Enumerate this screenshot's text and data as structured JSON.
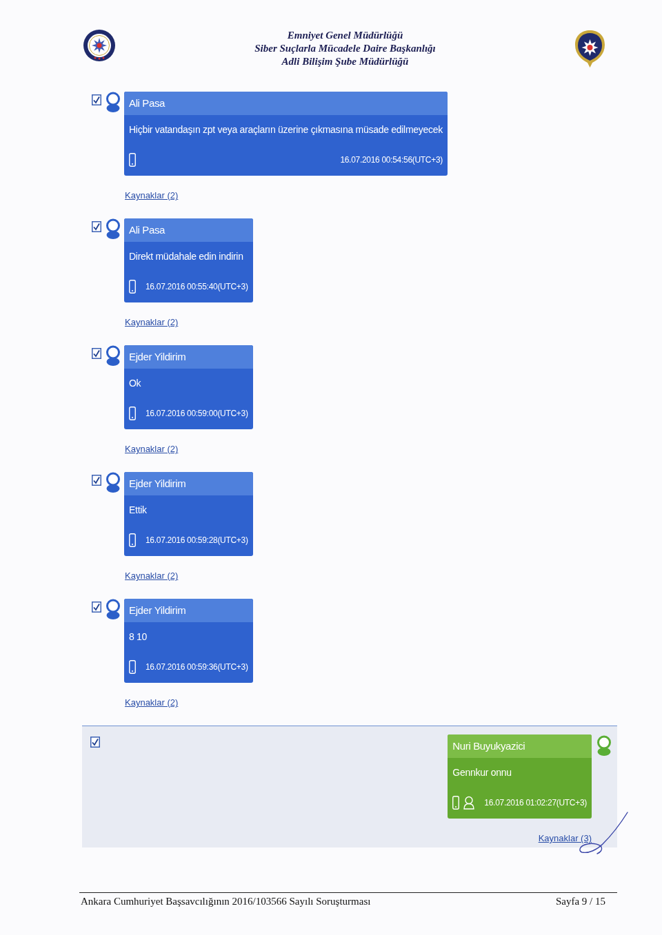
{
  "header": {
    "lines": [
      "Emniyet Genel Müdürlüğü",
      "Siber Suçlarla Mücadele Daire Başkanlığı",
      "Adli Bilişim Şube Müdürlüğü"
    ]
  },
  "messages": [
    {
      "kind": "incoming",
      "checked": true,
      "selected": false,
      "sender": "Ali Pasa",
      "text": "Hiçbir vatandaşın zpt veya araçların üzerine çıkmasına müsade edilmeyecek",
      "timestamp": "16.07.2016 00:54:56(UTC+3)",
      "sources": "Kaynaklar (2)"
    },
    {
      "kind": "incoming",
      "checked": true,
      "selected": false,
      "sender": "Ali Pasa",
      "text": "Direkt müdahale edin indirin",
      "timestamp": "16.07.2016 00:55:40(UTC+3)",
      "sources": "Kaynaklar (2)"
    },
    {
      "kind": "incoming",
      "checked": true,
      "selected": false,
      "sender": "Ejder Yildirim",
      "text": "Ok",
      "timestamp": "16.07.2016 00:59:00(UTC+3)",
      "sources": "Kaynaklar (2)"
    },
    {
      "kind": "incoming",
      "checked": true,
      "selected": false,
      "sender": "Ejder Yildirim",
      "text": "Ettik",
      "timestamp": "16.07.2016 00:59:28(UTC+3)",
      "sources": "Kaynaklar (2)"
    },
    {
      "kind": "incoming",
      "checked": true,
      "selected": false,
      "sender": "Ejder Yildirim",
      "text": "8 10",
      "timestamp": "16.07.2016 00:59:36(UTC+3)",
      "sources": "Kaynaklar (2)"
    },
    {
      "kind": "outgoing",
      "checked": true,
      "selected": true,
      "sender": "Nuri Buyukyazici",
      "text": "Gennkur onnu",
      "timestamp": "16.07.2016 01:02:27(UTC+3)",
      "sources": "Kaynaklar (3)"
    }
  ],
  "footer": {
    "case": "Ankara Cumhuriyet Başsavcılığının 2016/103566 Sayılı Soruşturması",
    "page": "Sayfa 9 / 15"
  }
}
